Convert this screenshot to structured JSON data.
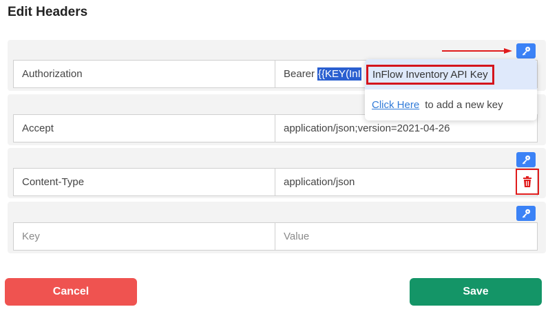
{
  "title": "Edit Headers",
  "rows": [
    {
      "key": "Authorization",
      "value_prefix": "Bearer",
      "value_selected": "{{KEY(InI"
    },
    {
      "key": "Accept",
      "value": "application/json;version=2021-04-26"
    },
    {
      "key": "Content-Type",
      "value": "application/json"
    },
    {
      "key_placeholder": "Key",
      "value_placeholder": "Value"
    }
  ],
  "dropdown": {
    "option": "InFlow Inventory API Key",
    "link_text": "Click Here",
    "hint_text": "to add a new key"
  },
  "buttons": {
    "cancel": "Cancel",
    "save": "Save"
  },
  "colors": {
    "accent_blue": "#3b82f6",
    "cancel_red": "#ef5350",
    "save_green": "#149567",
    "annotation_red": "#e01b1b"
  },
  "icons": {
    "key": "key-icon",
    "trash": "trash-icon",
    "arrow": "arrow-right-icon"
  }
}
